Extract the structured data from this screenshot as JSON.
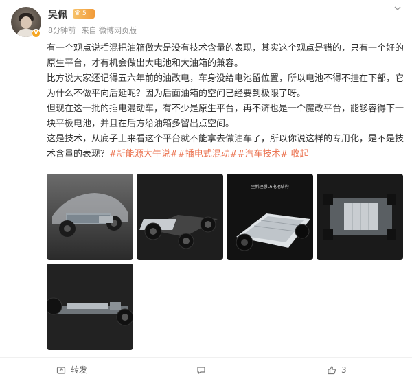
{
  "user": {
    "name": "吴佩",
    "level_badge": "5",
    "verified_badge": "V"
  },
  "meta": {
    "time": "8分钟前",
    "source": "来自 微博网页版"
  },
  "post": {
    "paragraph1": "有一个观点说插混把油箱做大是没有技术含量的表现，其实这个观点是错的，只有一个好的原生平台，才有机会做出大电池和大油箱的兼容。",
    "paragraph2": "比方说大家还记得五六年前的油改电，车身没给电池留位置，所以电池不得不挂在下部，它为什么不做平向后延呢？因为后面油箱的空间已经要到极限了呀。",
    "paragraph3": "但现在这一批的插电混动车，有不少是原生平台，再不济也是一个魔改平台，能够容得下一块平板电池，并且在后方给油箱多留出点空间。",
    "paragraph4_text": "这是技术，从底子上来看这个平台就不能拿去做油车了，所以你说这样的专用化，是不是技术含量的表现？",
    "tags": [
      "#新能源大牛说#",
      "#插电式混动#",
      "#汽车技术#"
    ],
    "collapse_label": "收起"
  },
  "images": [
    {
      "alt": "car-chassis-transparent-body"
    },
    {
      "alt": "platform-chassis-dark"
    },
    {
      "alt": "battery-structure",
      "caption": "全新理想L6电池结构"
    },
    {
      "alt": "chassis-top-view"
    },
    {
      "alt": "chassis-side-view"
    }
  ],
  "actions": {
    "share_label": "转发",
    "like_count": "3"
  }
}
